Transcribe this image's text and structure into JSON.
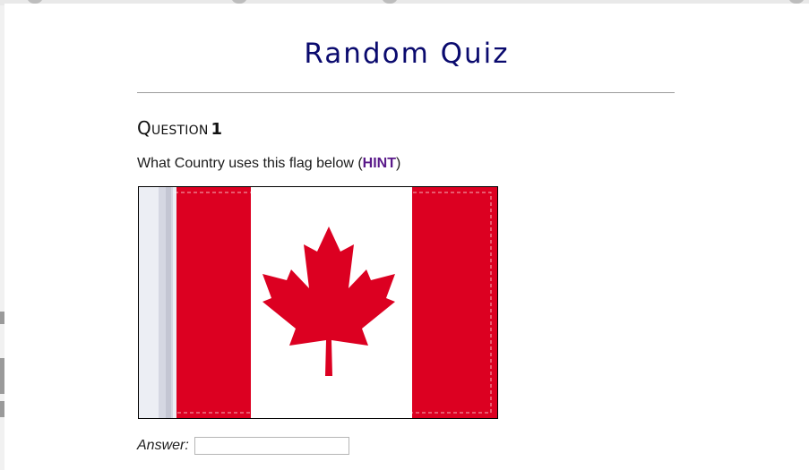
{
  "page": {
    "title": "Random Quiz"
  },
  "question": {
    "heading_word": "Question",
    "number": "1",
    "prompt_before": "What Country uses this flag below (",
    "hint_label": "HINT",
    "prompt_after": ")"
  },
  "flag_image": {
    "depicts": "canada-flag",
    "colors": {
      "red": "#dc0021",
      "white": "#ffffff",
      "pole": "#e6e6ee"
    }
  },
  "answer": {
    "label": "Answer:",
    "value": "",
    "placeholder": ""
  }
}
